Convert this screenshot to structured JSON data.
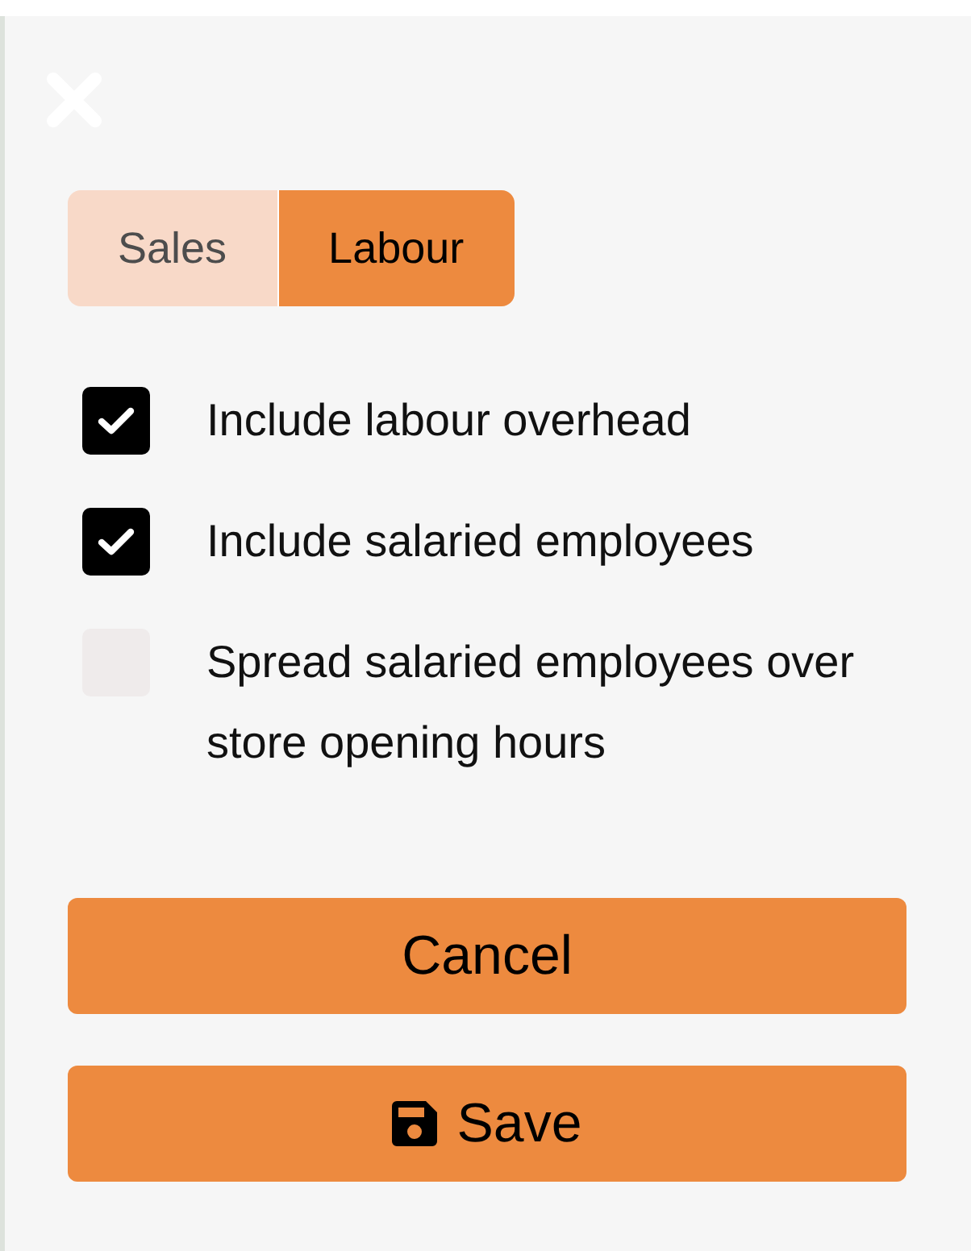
{
  "tabs": [
    {
      "label": "Sales",
      "selected": false
    },
    {
      "label": "Labour",
      "selected": true
    }
  ],
  "options": [
    {
      "label": "Include labour overhead",
      "checked": true
    },
    {
      "label": "Include salaried employees",
      "checked": true
    },
    {
      "label": "Spread salaried employees over store opening hours",
      "checked": false
    }
  ],
  "buttons": [
    {
      "label": "Cancel",
      "kind": "cancel"
    },
    {
      "label": "Save",
      "kind": "save"
    }
  ]
}
